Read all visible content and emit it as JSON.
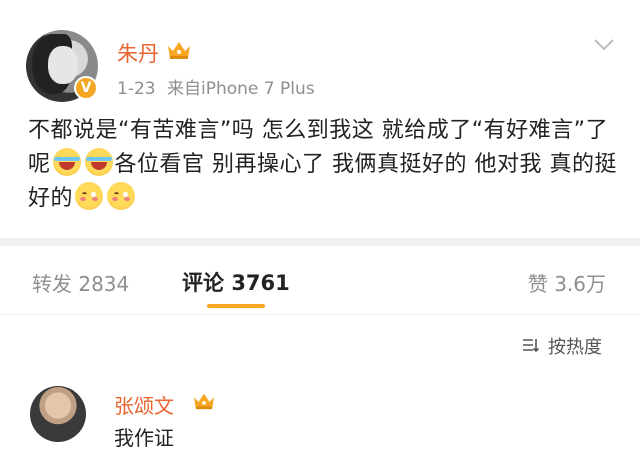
{
  "post": {
    "username": "朱丹",
    "time": "1-23",
    "source": "来自iPhone 7 Plus",
    "verified_badge": "V",
    "content_parts": [
      "不都说是“有苦难言”吗 怎么到我这 就给成了“有好难言”了呢",
      "各位看官 别再操心了 我俩真挺好的 他对我 真的挺好的"
    ]
  },
  "tabs": {
    "repost_label": "转发",
    "repost_count": "2834",
    "comment_label": "评论",
    "comment_count": "3761",
    "like_label": "赞",
    "like_count": "3.6万"
  },
  "sort": {
    "label": "按热度"
  },
  "comment": {
    "username": "张颂文",
    "text": "我作证"
  },
  "icons": {
    "crown": "crown-icon",
    "chevron": "chevron-down-icon",
    "sort": "sort-icon",
    "emoji_laugh": "laugh-cry-emoji-icon",
    "emoji_shy": "shy-smile-emoji-icon"
  },
  "colors": {
    "username": "#e8652e",
    "accent": "#f5a623",
    "meta": "#8f8f8f"
  }
}
